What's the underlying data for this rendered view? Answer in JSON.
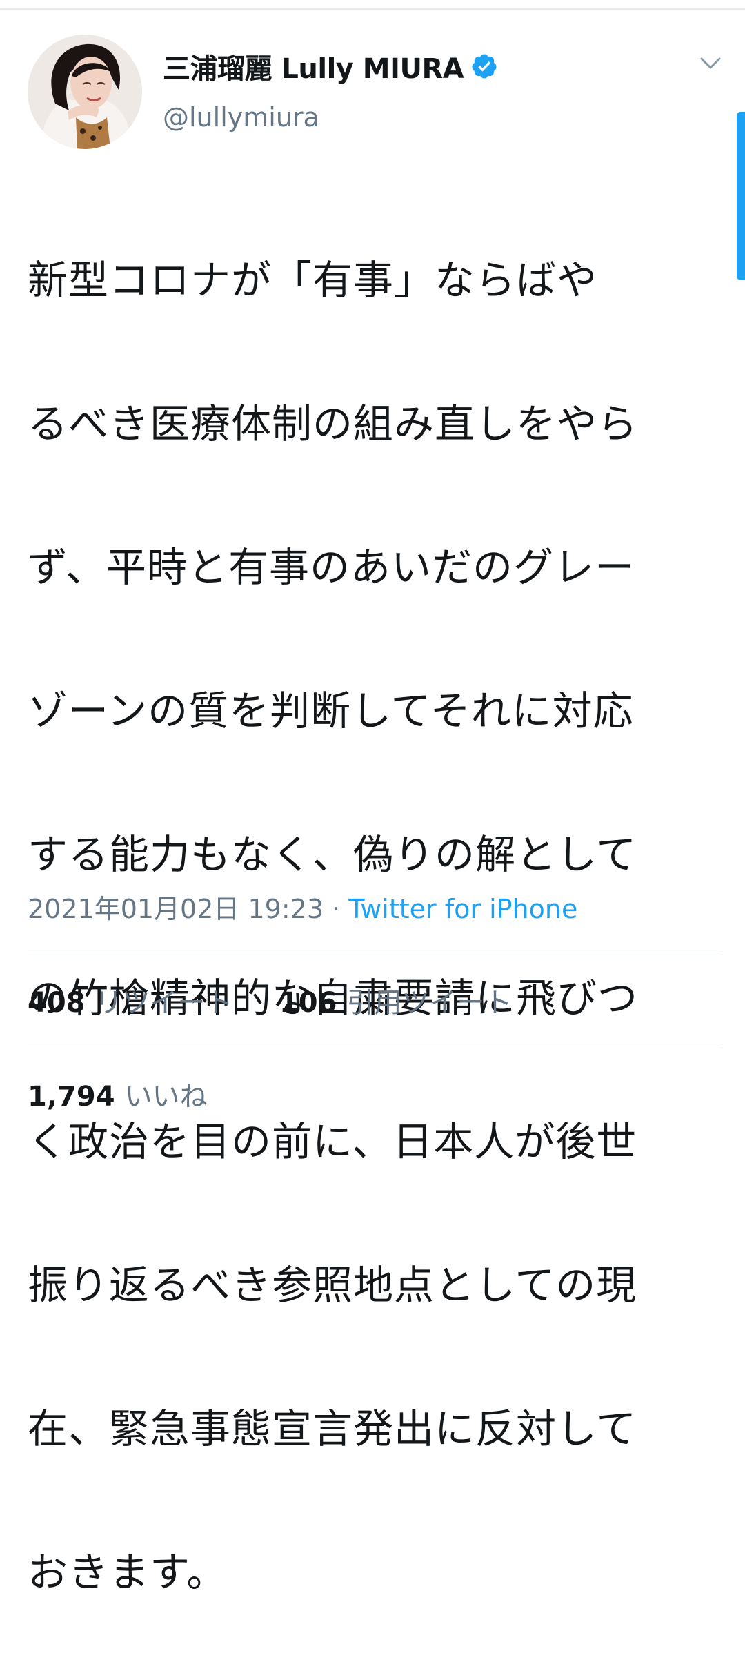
{
  "author": {
    "display_name": "三浦瑠麗 Lully MIURA",
    "handle": "@lullymiura",
    "verified": true
  },
  "tweet": {
    "lines": [
      "新型コロナが「有事」ならばや",
      "るべき医療体制の組み直しをやら",
      "ず、平時と有事のあいだのグレー",
      "ゾーンの質を判断してそれに対応",
      "する能力もなく、偽りの解として",
      "の竹槍精神的な自粛要請に飛びつ",
      "く政治を目の前に、日本人が後世",
      "振り返るべき参照地点としての現",
      "在、緊急事態宣言発出に反対して",
      "おきます。"
    ],
    "timestamp": "2021年01月02日 19:23",
    "separator": "·",
    "source": "Twitter for iPhone"
  },
  "stats": {
    "retweets": {
      "count": "408",
      "label": "リツイート"
    },
    "quote_tweets": {
      "count": "106",
      "label": "引用ツイート"
    },
    "likes": {
      "count": "1,794",
      "label": "いいね"
    }
  },
  "icons": {
    "verified": "verified-badge-icon",
    "more": "chevron-down-icon"
  },
  "colors": {
    "accent": "#1da1f2",
    "text": "#14171a",
    "muted": "#657786",
    "divider": "#e1e8ed"
  }
}
